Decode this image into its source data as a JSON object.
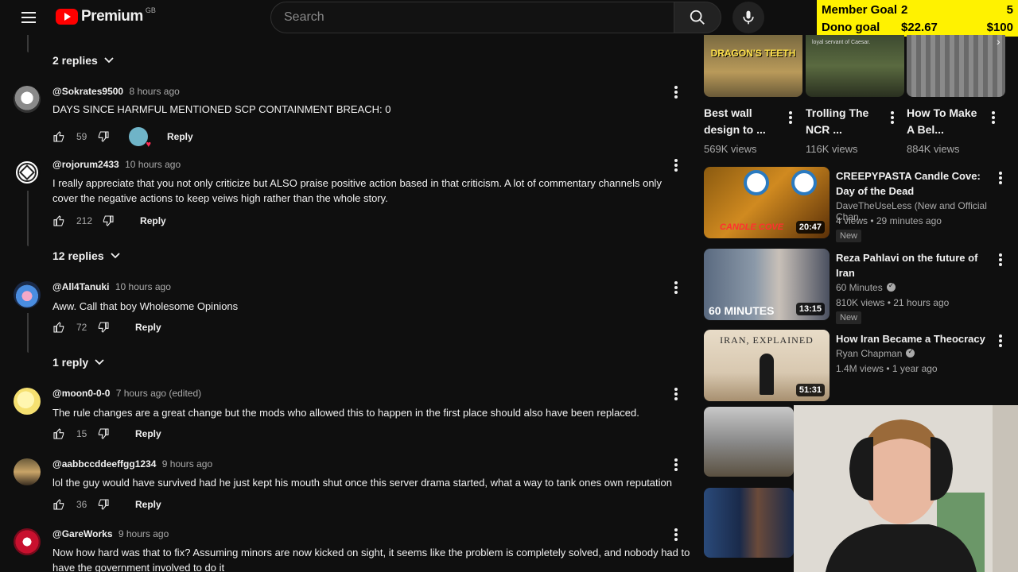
{
  "header": {
    "logo_text": "Premium",
    "country": "GB",
    "search_placeholder": "Search"
  },
  "goal_overlay": {
    "rows": [
      {
        "label": "Member Goal",
        "current": "2",
        "target": "5"
      },
      {
        "label": "Dono goal",
        "current": "$22.67",
        "target": "$100"
      }
    ]
  },
  "comments": {
    "top_replies_toggle": "2 replies",
    "items": [
      {
        "username": "@Sokrates9500",
        "time": "8 hours ago",
        "text": "DAYS SINCE HARMFUL MENTIONED SCP CONTAINMENT BREACH: 0",
        "likes": "59",
        "reply_label": "Reply",
        "creator_heart": true,
        "replies_toggle": ""
      },
      {
        "username": "@rojorum2433",
        "time": "10 hours ago",
        "text": "I really appreciate that you not only criticize but ALSO praise positive action based in that criticism. A lot of commentary channels only cover the negative actions to keep veiws high rather than the whole story.",
        "likes": "212",
        "reply_label": "Reply",
        "replies_toggle": "12 replies"
      },
      {
        "username": "@All4Tanuki",
        "time": "10 hours ago",
        "text": "Aww. Call that boy Wholesome Opinions",
        "likes": "72",
        "reply_label": "Reply",
        "replies_toggle": "1 reply"
      },
      {
        "username": "@moon0-0-0",
        "time": "7 hours ago (edited)",
        "text": "The rule changes are a great change but the mods who allowed this to happen in the first place should also have been replaced.",
        "likes": "15",
        "reply_label": "Reply",
        "replies_toggle": ""
      },
      {
        "username": "@aabbccddeeffgg1234",
        "time": "9 hours ago",
        "text": "lol the guy would have survived had he just kept his mouth shut once this server drama started, what a way to tank ones own reputation",
        "likes": "36",
        "reply_label": "Reply",
        "replies_toggle": ""
      },
      {
        "username": "@GareWorks",
        "time": "9 hours ago",
        "text": "Now how hard was that to fix? Assuming minors are now kicked on sight, it seems like the problem is completely solved, and nobody had to have the government involved to do it",
        "likes": "",
        "reply_label": "Reply",
        "replies_toggle": ""
      }
    ]
  },
  "sidebar": {
    "shorts": [
      {
        "title": "Best wall design to ...",
        "views": "569K views",
        "thumb_text": "DRAGON'S TEETH"
      },
      {
        "title": "Trolling The NCR ...",
        "views": "116K views",
        "thumb_text": "loyal servant of Caesar."
      },
      {
        "title": "How To Make A Bel...",
        "views": "884K views",
        "thumb_text": ""
      }
    ],
    "videos": [
      {
        "title": "CREEPYPASTA Candle Cove: Day of the Dead",
        "channel": "DaveTheUseLess (New and Official Chan...",
        "meta": "4 views • 29 minutes ago",
        "badge": "New",
        "duration": "20:47",
        "thumb_text": "CANDLE COVE",
        "verified": false
      },
      {
        "title": "Reza Pahlavi on the future of Iran",
        "channel": "60 Minutes",
        "meta": "810K views • 21 hours ago",
        "badge": "New",
        "duration": "13:15",
        "thumb_text": "60 MINUTES",
        "verified": true
      },
      {
        "title": "How Iran Became a Theocracy",
        "channel": "Ryan Chapman",
        "meta": "1.4M views • 1 year ago",
        "badge": "",
        "duration": "51:31",
        "thumb_text": "IRAN, EXPLAINED",
        "verified": true
      }
    ]
  },
  "colors": {
    "background": "#0f0f0f",
    "goal_yellow": "#fff200",
    "brand_red": "#ff0000"
  }
}
